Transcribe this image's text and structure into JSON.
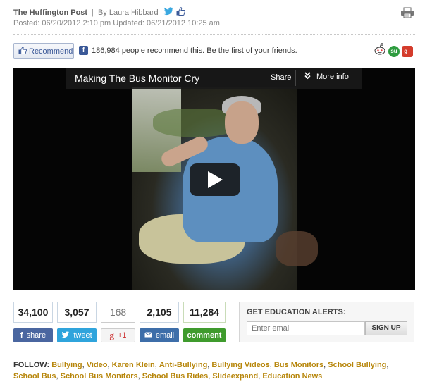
{
  "byline": {
    "publication": "The Huffington Post",
    "separator": "|",
    "author": "By Laura Hibbard",
    "posted": "Posted: 06/20/2012 2:10 pm Updated: 06/21/2012 10:25 am"
  },
  "recommend": {
    "button_label": "Recommend",
    "fb_text": "186,984 people recommend this. Be the first of your friends.",
    "social_icons": [
      "reddit-icon",
      "stumbleupon-icon",
      "google-plus-icon"
    ]
  },
  "video": {
    "title": "Making The Bus Monitor Cry",
    "share_label": "Share",
    "more_info_label": "More info"
  },
  "share_bar": {
    "facebook": {
      "count": "34,100",
      "label": "share"
    },
    "twitter": {
      "count": "3,057",
      "label": "tweet"
    },
    "googleplus": {
      "count": "168",
      "label": "+1"
    },
    "email": {
      "count": "2,105",
      "label": "email"
    },
    "comment": {
      "count": "11,284",
      "label": "comment"
    }
  },
  "alerts": {
    "title": "GET EDUCATION ALERTS:",
    "placeholder": "Enter email",
    "button": "SIGN UP"
  },
  "follow": {
    "label": "FOLLOW:",
    "tags": [
      "Bullying",
      "Video",
      "Karen Klein",
      "Anti-Bullying",
      "Bullying Videos",
      "Bus Monitors",
      "School Bullying",
      "School Bus",
      "School Bus Monitors",
      "School Bus Rides",
      "Slideexpand",
      "Education News"
    ]
  },
  "colors": {
    "facebook": "#4a66a0",
    "twitter": "#2fa4dc",
    "email": "#3d6ea9",
    "comment": "#3f9b2d",
    "tag_link": "#b7860b"
  }
}
